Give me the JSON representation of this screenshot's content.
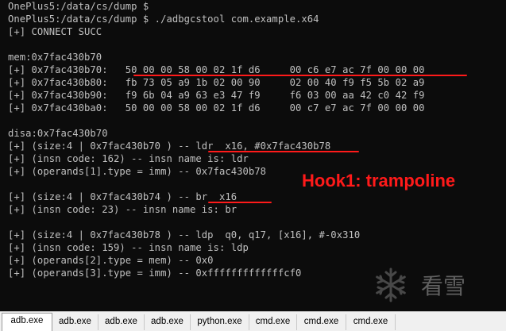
{
  "terminal": {
    "lines": [
      "OnePlus5:/data/cs/dump $",
      "OnePlus5:/data/cs/dump $ ./adbgcstool com.example.x64",
      "[+] CONNECT SUCC",
      "",
      "mem:0x7fac430b70",
      "[+] 0x7fac430b70:   50 00 00 58 00 02 1f d6     00 c6 e7 ac 7f 00 00 00",
      "[+] 0x7fac430b80:   fb 73 05 a9 1b 02 00 90     02 00 40 f9 f5 5b 02 a9",
      "[+] 0x7fac430b90:   f9 6b 04 a9 63 e3 47 f9     f6 03 00 aa 42 c0 42 f9",
      "[+] 0x7fac430ba0:   50 00 00 58 00 02 1f d6     00 c7 e7 ac 7f 00 00 00",
      "",
      "disa:0x7fac430b70",
      "[+] (size:4 | 0x7fac430b70 ) -- ldr  x16, #0x7fac430b78",
      "[+] (insn code: 162) -- insn name is: ldr",
      "[+] (operands[1].type = imm) -- 0x7fac430b78",
      "",
      "[+] (size:4 | 0x7fac430b74 ) -- br  x16",
      "[+] (insn code: 23) -- insn name is: br",
      "",
      "[+] (size:4 | 0x7fac430b78 ) -- ldp  q0, q17, [x16], #-0x310",
      "[+] (insn code: 159) -- insn name is: ldp",
      "[+] (operands[2].type = mem) -- 0x0",
      "[+] (operands[3].type = imm) -- 0xfffffffffffffcf0"
    ]
  },
  "annotation": {
    "label": "Hook1: trampoline",
    "color": "#ff1a1a"
  },
  "watermark": {
    "text": "看雪",
    "icon": "snowflake-icon"
  },
  "taskbar": {
    "tabs": [
      {
        "label": "adb.exe",
        "active": true
      },
      {
        "label": "adb.exe",
        "active": false
      },
      {
        "label": "adb.exe",
        "active": false
      },
      {
        "label": "adb.exe",
        "active": false
      },
      {
        "label": "python.exe",
        "active": false
      },
      {
        "label": "cmd.exe",
        "active": false
      },
      {
        "label": "cmd.exe",
        "active": false
      },
      {
        "label": "cmd.exe",
        "active": false
      }
    ]
  }
}
